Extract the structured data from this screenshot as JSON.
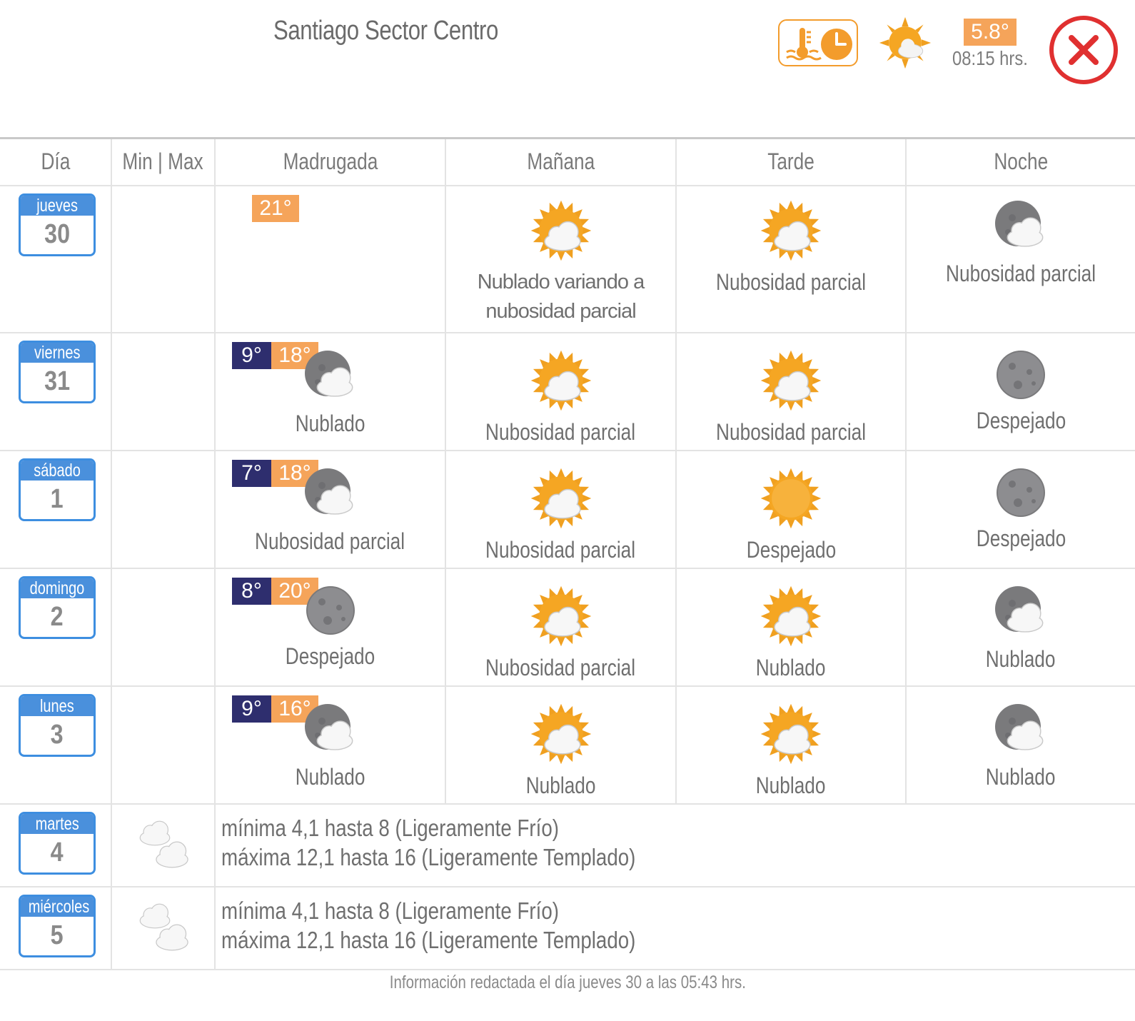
{
  "header": {
    "title": "Santiago Sector Centro",
    "current_temp": "5.8°",
    "current_time": "08:15 hrs."
  },
  "columns": [
    "Día",
    "Min | Max",
    "Madrugada",
    "Mañana",
    "Tarde",
    "Noche"
  ],
  "colors": {
    "min_badge": "#2e2e6e",
    "max_badge": "#f5a45a",
    "calendar_blue": "#4a90dc",
    "close_red": "#e03030"
  },
  "days": [
    {
      "weekday": "jueves",
      "day": "30",
      "min": "",
      "max": "21°",
      "periods": [
        null,
        {
          "icon": "sun-cloud-icon",
          "label": "Nublado variando a nubosidad parcial"
        },
        {
          "icon": "sun-cloud-icon",
          "label": "Nubosidad parcial"
        },
        {
          "icon": "moon-cloud-icon",
          "label": "Nubosidad parcial"
        }
      ]
    },
    {
      "weekday": "viernes",
      "day": "31",
      "min": "9°",
      "max": "18°",
      "periods": [
        {
          "icon": "moon-cloud-icon",
          "label": "Nublado"
        },
        {
          "icon": "sun-cloud-icon",
          "label": "Nubosidad parcial"
        },
        {
          "icon": "sun-cloud-icon",
          "label": "Nubosidad parcial"
        },
        {
          "icon": "moon-icon",
          "label": "Despejado"
        }
      ]
    },
    {
      "weekday": "sábado",
      "day": "1",
      "min": "7°",
      "max": "18°",
      "periods": [
        {
          "icon": "moon-cloud-icon",
          "label": "Nubosidad parcial"
        },
        {
          "icon": "sun-cloud-icon",
          "label": "Nubosidad parcial"
        },
        {
          "icon": "sun-icon",
          "label": "Despejado"
        },
        {
          "icon": "moon-icon",
          "label": "Despejado"
        }
      ]
    },
    {
      "weekday": "domingo",
      "day": "2",
      "min": "8°",
      "max": "20°",
      "periods": [
        {
          "icon": "moon-icon",
          "label": "Despejado"
        },
        {
          "icon": "sun-cloud-icon",
          "label": "Nubosidad parcial"
        },
        {
          "icon": "sun-cloud-icon",
          "label": "Nublado"
        },
        {
          "icon": "moon-cloud-icon",
          "label": "Nublado"
        }
      ]
    },
    {
      "weekday": "lunes",
      "day": "3",
      "min": "9°",
      "max": "16°",
      "periods": [
        {
          "icon": "moon-cloud-icon",
          "label": "Nublado"
        },
        {
          "icon": "sun-cloud-icon",
          "label": "Nublado"
        },
        {
          "icon": "sun-cloud-icon",
          "label": "Nublado"
        },
        {
          "icon": "moon-cloud-icon",
          "label": "Nublado"
        }
      ]
    }
  ],
  "extended": [
    {
      "weekday": "martes",
      "day": "4",
      "icon": "clouds-icon",
      "line1": "mínima 4,1 hasta 8 (Ligeramente Frío)",
      "line2": "máxima 12,1 hasta 16 (Ligeramente Templado)"
    },
    {
      "weekday": "miércoles",
      "day": "5",
      "icon": "clouds-icon",
      "line1": "mínima 4,1 hasta 8 (Ligeramente Frío)",
      "line2": "máxima 12,1 hasta 16 (Ligeramente Templado)"
    }
  ],
  "footer": "Información redactada el día jueves 30 a las 05:43 hrs."
}
